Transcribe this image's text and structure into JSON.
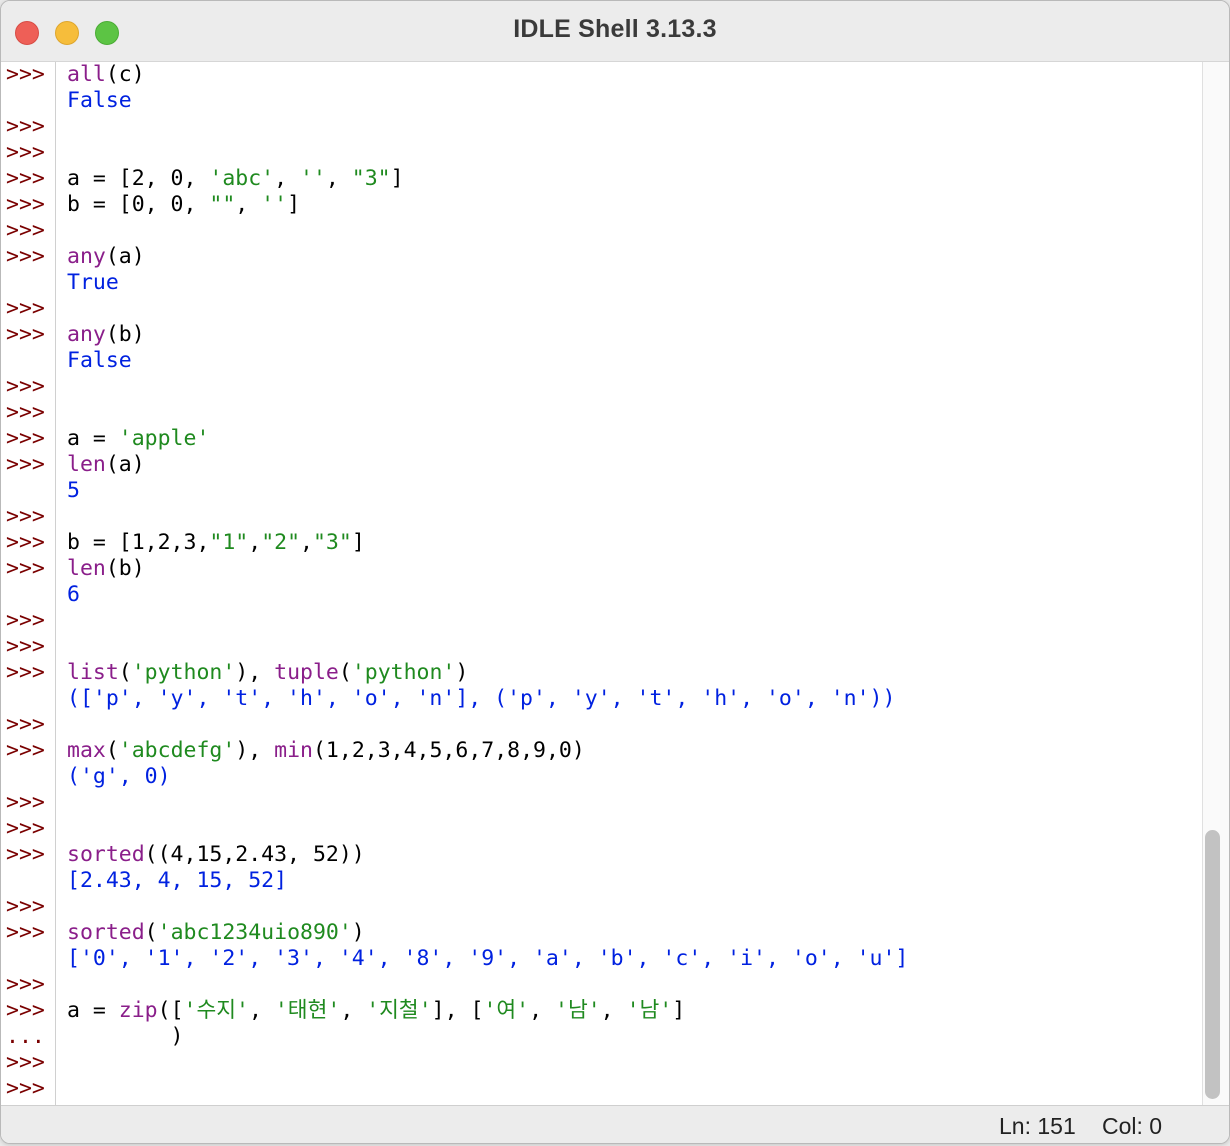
{
  "window": {
    "title": "IDLE Shell 3.13.3"
  },
  "gutter": [
    ">>>",
    "",
    ">>>",
    ">>>",
    ">>>",
    ">>>",
    ">>>",
    ">>>",
    "",
    ">>>",
    ">>>",
    "",
    ">>>",
    ">>>",
    ">>>",
    ">>>",
    "",
    ">>>",
    ">>>",
    ">>>",
    "",
    ">>>",
    ">>>",
    ">>>",
    "",
    ">>>",
    ">>>",
    "",
    ">>>",
    ">>>",
    ">>>",
    "",
    ">>>",
    ">>>",
    "",
    ">>>",
    ">>>",
    "...",
    ">>>",
    ">>>"
  ],
  "shell_lines": [
    {
      "segments": [
        {
          "t": "all",
          "c": "kw"
        },
        {
          "t": "(c)"
        }
      ]
    },
    {
      "segments": [
        {
          "t": "False",
          "c": "out"
        }
      ]
    },
    {
      "segments": []
    },
    {
      "segments": []
    },
    {
      "segments": [
        {
          "t": "a = [2, 0, "
        },
        {
          "t": "'abc'",
          "c": "str"
        },
        {
          "t": ", "
        },
        {
          "t": "''",
          "c": "str"
        },
        {
          "t": ", "
        },
        {
          "t": "\"3\"",
          "c": "str"
        },
        {
          "t": "]"
        }
      ]
    },
    {
      "segments": [
        {
          "t": "b = [0, 0, "
        },
        {
          "t": "\"\"",
          "c": "str"
        },
        {
          "t": ", "
        },
        {
          "t": "''",
          "c": "str"
        },
        {
          "t": "]"
        }
      ]
    },
    {
      "segments": []
    },
    {
      "segments": [
        {
          "t": "any",
          "c": "kw"
        },
        {
          "t": "(a)"
        }
      ]
    },
    {
      "segments": [
        {
          "t": "True",
          "c": "out"
        }
      ]
    },
    {
      "segments": []
    },
    {
      "segments": [
        {
          "t": "any",
          "c": "kw"
        },
        {
          "t": "(b)"
        }
      ]
    },
    {
      "segments": [
        {
          "t": "False",
          "c": "out"
        }
      ]
    },
    {
      "segments": []
    },
    {
      "segments": []
    },
    {
      "segments": [
        {
          "t": "a = "
        },
        {
          "t": "'apple'",
          "c": "str"
        }
      ]
    },
    {
      "segments": [
        {
          "t": "len",
          "c": "kw"
        },
        {
          "t": "(a)"
        }
      ]
    },
    {
      "segments": [
        {
          "t": "5",
          "c": "out"
        }
      ]
    },
    {
      "segments": []
    },
    {
      "segments": [
        {
          "t": "b = [1,2,3,"
        },
        {
          "t": "\"1\"",
          "c": "str"
        },
        {
          "t": ","
        },
        {
          "t": "\"2\"",
          "c": "str"
        },
        {
          "t": ","
        },
        {
          "t": "\"3\"",
          "c": "str"
        },
        {
          "t": "]"
        }
      ]
    },
    {
      "segments": [
        {
          "t": "len",
          "c": "kw"
        },
        {
          "t": "(b)"
        }
      ]
    },
    {
      "segments": [
        {
          "t": "6",
          "c": "out"
        }
      ]
    },
    {
      "segments": []
    },
    {
      "segments": []
    },
    {
      "segments": [
        {
          "t": "list",
          "c": "kw"
        },
        {
          "t": "("
        },
        {
          "t": "'python'",
          "c": "str"
        },
        {
          "t": "), "
        },
        {
          "t": "tuple",
          "c": "kw"
        },
        {
          "t": "("
        },
        {
          "t": "'python'",
          "c": "str"
        },
        {
          "t": ")"
        }
      ]
    },
    {
      "segments": [
        {
          "t": "(['p', 'y', 't', 'h', 'o', 'n'], ('p', 'y', 't', 'h', 'o', 'n'))",
          "c": "out"
        }
      ]
    },
    {
      "segments": []
    },
    {
      "segments": [
        {
          "t": "max",
          "c": "kw"
        },
        {
          "t": "("
        },
        {
          "t": "'abcdefg'",
          "c": "str"
        },
        {
          "t": "), "
        },
        {
          "t": "min",
          "c": "kw"
        },
        {
          "t": "(1,2,3,4,5,6,7,8,9,0)"
        }
      ]
    },
    {
      "segments": [
        {
          "t": "('g', 0)",
          "c": "out"
        }
      ]
    },
    {
      "segments": []
    },
    {
      "segments": []
    },
    {
      "segments": [
        {
          "t": "sorted",
          "c": "kw"
        },
        {
          "t": "((4,15,2.43, 52))"
        }
      ]
    },
    {
      "segments": [
        {
          "t": "[2.43, 4, 15, 52]",
          "c": "out"
        }
      ]
    },
    {
      "segments": []
    },
    {
      "segments": [
        {
          "t": "sorted",
          "c": "kw"
        },
        {
          "t": "("
        },
        {
          "t": "'abc1234uio890'",
          "c": "str"
        },
        {
          "t": ")"
        }
      ]
    },
    {
      "segments": [
        {
          "t": "['0', '1', '2', '3', '4', '8', '9', 'a', 'b', 'c', 'i', 'o', 'u']",
          "c": "out"
        }
      ]
    },
    {
      "segments": []
    },
    {
      "segments": [
        {
          "t": "a = "
        },
        {
          "t": "zip",
          "c": "kw"
        },
        {
          "t": "(["
        },
        {
          "t": "'수지'",
          "c": "str"
        },
        {
          "t": ", "
        },
        {
          "t": "'태현'",
          "c": "str"
        },
        {
          "t": ", "
        },
        {
          "t": "'지철'",
          "c": "str"
        },
        {
          "t": "], ["
        },
        {
          "t": "'여'",
          "c": "str"
        },
        {
          "t": ", "
        },
        {
          "t": "'남'",
          "c": "str"
        },
        {
          "t": ", "
        },
        {
          "t": "'남'",
          "c": "str"
        },
        {
          "t": "]"
        }
      ]
    },
    {
      "segments": [
        {
          "t": "        )"
        }
      ]
    },
    {
      "segments": []
    },
    {
      "segments": []
    }
  ],
  "status": {
    "line": "Ln: 151",
    "col": "Col: 0"
  },
  "colors": {
    "prompt": "#7a0000",
    "keyword": "#8a1e8a",
    "string": "#1f8a1f",
    "output": "#0021e0"
  }
}
